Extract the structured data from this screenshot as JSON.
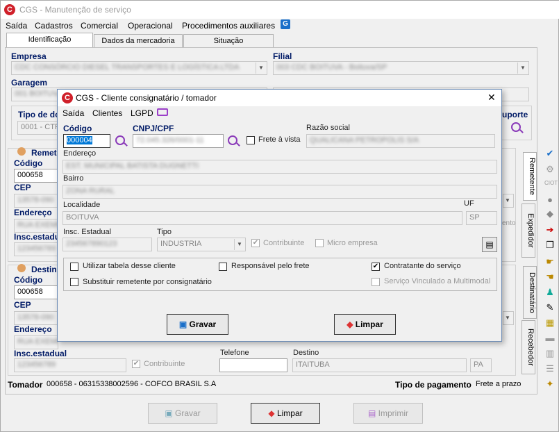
{
  "main": {
    "title": "CGS - Manutenção de serviço",
    "menu": [
      "Saída",
      "Cadastros",
      "Comercial",
      "Operacional",
      "Procedimentos auxiliares"
    ],
    "tabs": [
      "Identificação",
      "Dados da mercadoria",
      "Situação"
    ],
    "empresa_label": "Empresa",
    "empresa_value": "CDC CONSÓRCIO DIESEL TRANSPORTES E LOGÍSTICA LTDA",
    "filial_label": "Filial",
    "filial_value": "003 CDC BOITUVA - Boituva/SP",
    "garagem_label": "Garagem",
    "garagem_value": "001 BOITUVA",
    "tipo_label": "Tipo de do",
    "tipo_value": "0001 - CTR",
    "suporte_label": "uporte",
    "remetente_label": "Remet",
    "destinatario_label": "Destin",
    "codigo_label": "Código",
    "cep_label": "CEP",
    "endereco_label": "Endereço",
    "insc_label": "Insc.estadual",
    "rem_codigo": "000658",
    "dest_codigo": "000658",
    "rem_cep": "13578-090",
    "dest_cep": "13578-090",
    "rem_endereco": "RUA EXEMPLO CENTRO",
    "dest_endereco": "RUA EXEMPLO CENTRO",
    "rem_insc": "123456789",
    "dest_insc": "123456789",
    "contribuinte": "Contribuinte",
    "telefone_label": "Telefone",
    "destino_label": "Destino",
    "destino_value": "ITAITUBA",
    "destino_uf": "PA",
    "ie_val": "ento",
    "tomador_label": "Tomador",
    "tomador_value": "000658 - 06315338002596 - COFCO BRASIL S.A",
    "tipo_pagto_label": "Tipo de pagamento",
    "tipo_pagto_value": "Frete a prazo",
    "btn_gravar": "Gravar",
    "btn_limpar": "Limpar",
    "btn_imprimir": "Imprimir",
    "vtabs": [
      "Remetente",
      "Expedidor",
      "Destinatário",
      "Recebedor"
    ]
  },
  "dialog": {
    "title": "CGS - Cliente consignatário / tomador",
    "menu": [
      "Saída",
      "Clientes",
      "LGPD"
    ],
    "codigo_label": "Código",
    "codigo_value": "000004",
    "cnpj_label": "CNPJ/CPF",
    "cnpj_value": "72.045.326/0001-11",
    "frete_vista": "Frete à vista",
    "razao_label": "Razão social",
    "razao_value": "QUALICANA PETROPOLIS S/A",
    "endereco_label": "Endereço",
    "endereco_value": "EST. MUNICIPAL BATISTA DUGNETTI",
    "bairro_label": "Bairro",
    "bairro_value": "ZONA RURAL",
    "localidade_label": "Localidade",
    "localidade_value": "BOITUVA",
    "uf_label": "UF",
    "uf_value": "SP",
    "insc_label": "Insc. Estadual",
    "insc_value": "234567890123",
    "tipo_label": "Tipo",
    "tipo_value": "INDUSTRIA",
    "contribuinte": "Contribuinte",
    "micro": "Micro empresa",
    "opt_tabela": "Utilizar tabela desse cliente",
    "opt_resp": "Responsável pelo frete",
    "opt_contratante": "Contratante do serviço",
    "opt_substituir": "Substituir remetente por consignatário",
    "opt_multimodal": "Serviço Vinculado a Multimodal",
    "btn_gravar": "Gravar",
    "btn_limpar": "Limpar",
    "close": "✕"
  }
}
